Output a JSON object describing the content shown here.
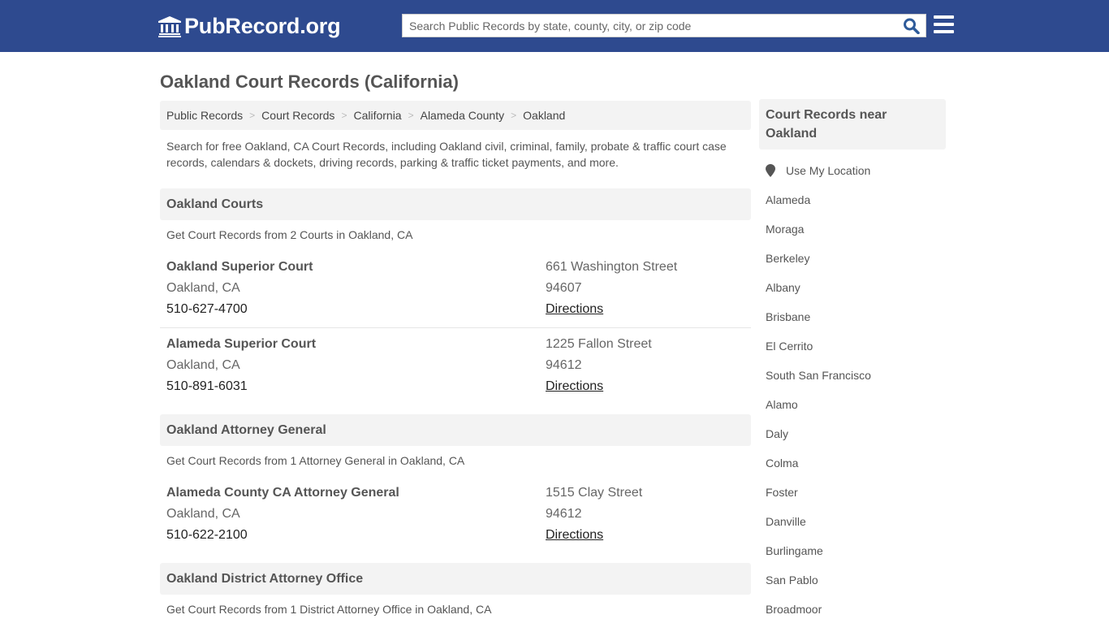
{
  "header": {
    "logo_text": "PubRecord.org",
    "search_placeholder": "Search Public Records by state, county, city, or zip code",
    "brand_color": "#2e4a8f"
  },
  "page": {
    "title": "Oakland Court Records (California)",
    "breadcrumb": [
      "Public Records",
      "Court Records",
      "California",
      "Alameda County",
      "Oakland"
    ],
    "intro": "Search for free Oakland, CA Court Records, including Oakland civil, criminal, family, probate & traffic court case records, calendars & dockets, driving records, parking & traffic ticket payments, and more."
  },
  "sections": [
    {
      "title": "Oakland Courts",
      "subtitle": "Get Court Records from 2 Courts in Oakland, CA",
      "entries": [
        {
          "name": "Oakland Superior Court",
          "city": "Oakland, CA",
          "phone": "510-627-4700",
          "street": "661 Washington Street",
          "zip": "94607",
          "link": "Directions"
        },
        {
          "name": "Alameda Superior Court",
          "city": "Oakland, CA",
          "phone": "510-891-6031",
          "street": "1225 Fallon Street",
          "zip": "94612",
          "link": "Directions"
        }
      ]
    },
    {
      "title": "Oakland Attorney General",
      "subtitle": "Get Court Records from 1 Attorney General in Oakland, CA",
      "entries": [
        {
          "name": "Alameda County CA Attorney General",
          "city": "Oakland, CA",
          "phone": "510-622-2100",
          "street": "1515 Clay Street",
          "zip": "94612",
          "link": "Directions"
        }
      ]
    },
    {
      "title": "Oakland District Attorney Office",
      "subtitle": "Get Court Records from 1 District Attorney Office in Oakland, CA",
      "entries": []
    }
  ],
  "sidebar": {
    "title": "Court Records near Oakland",
    "use_location": "Use My Location",
    "nearby": [
      "Alameda",
      "Moraga",
      "Berkeley",
      "Albany",
      "Brisbane",
      "El Cerrito",
      "South San Francisco",
      "Alamo",
      "Daly",
      "Colma",
      "Foster",
      "Danville",
      "Burlingame",
      "San Pablo",
      "Broadmoor"
    ]
  }
}
